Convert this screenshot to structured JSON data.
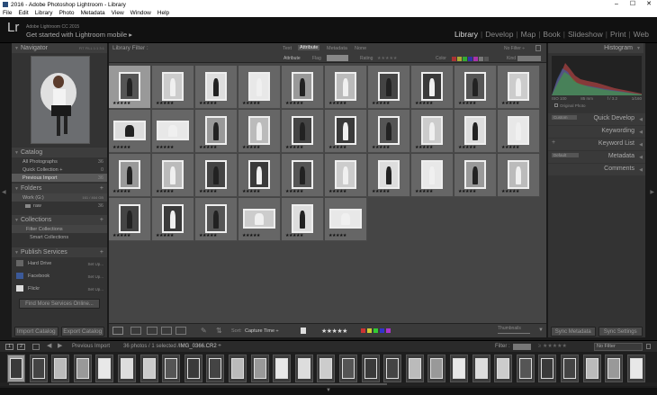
{
  "window": {
    "title": "2016 - Adobe Photoshop Lightroom - Library",
    "controls": [
      "–",
      "☐",
      "✕"
    ]
  },
  "menu": [
    "File",
    "Edit",
    "Library",
    "Photo",
    "Metadata",
    "View",
    "Window",
    "Help"
  ],
  "identity": {
    "logo": "Lr",
    "version": "Adobe Lightroom CC 2015",
    "promo": "Get started with Lightroom mobile ▸"
  },
  "modules": {
    "items": [
      "Library",
      "Develop",
      "Map",
      "Book",
      "Slideshow",
      "Print",
      "Web"
    ],
    "active": "Library"
  },
  "left": {
    "navigator": {
      "title": "Navigator",
      "zoom": "FIT  FILL  1:1  3:1"
    },
    "catalog": {
      "title": "Catalog",
      "items": [
        {
          "label": "All Photographs",
          "count": "36"
        },
        {
          "label": "Quick Collection +",
          "count": "0"
        },
        {
          "label": "Previous Import",
          "count": "36"
        }
      ]
    },
    "folders": {
      "title": "Folders",
      "drive": "Work (G:)",
      "drive_info": "161 / 464 GB",
      "items": [
        {
          "label": "raw",
          "count": "36"
        }
      ]
    },
    "collections": {
      "title": "Collections",
      "items": [
        "Filter Collections",
        "Smart Collections"
      ]
    },
    "publish": {
      "title": "Publish Services",
      "items": [
        {
          "label": "Hard Drive",
          "action": "Set Up..."
        },
        {
          "label": "Facebook",
          "action": "Set Up..."
        },
        {
          "label": "Flickr",
          "action": "Set Up..."
        }
      ],
      "find_more": "Find More Services Online..."
    },
    "buttons": {
      "import": "Import Catalog",
      "export": "Export Catalog"
    }
  },
  "filterbar": {
    "title": "Library Filter :",
    "tabs": [
      "Text",
      "Attribute",
      "Metadata",
      "None"
    ],
    "active_tab": "Attribute",
    "nofilter": "No Filter ÷",
    "attribute_label": "Attribute",
    "flag_label": "Flag",
    "rating_label": "Rating",
    "color_label": "Color",
    "kind_label": "Kind"
  },
  "grid": {
    "rows": [
      [
        1,
        2,
        3,
        4,
        5,
        6,
        7,
        8,
        9,
        10
      ],
      [
        11,
        12,
        13,
        14,
        15,
        16,
        17,
        18,
        19,
        20
      ],
      [
        21,
        22,
        23,
        24,
        25,
        26,
        27,
        28,
        29,
        30
      ],
      [
        31,
        32,
        33,
        34,
        35,
        36
      ]
    ],
    "selected": 1,
    "stars": "★★★★★"
  },
  "toolbar": {
    "sort_label": "Sort:",
    "sort_value": "Capture Time ÷",
    "stars": "★★★★★",
    "thumbnails_label": "Thumbnails"
  },
  "right": {
    "histogram": {
      "title": "Histogram",
      "iso": "ISO 100",
      "focal": "85 mm",
      "aperture": "f / 3.2",
      "shutter": "1/160",
      "original": "Original Photo"
    },
    "panels": [
      "Quick Develop",
      "Keywording",
      "Keyword List",
      "Metadata",
      "Comments"
    ],
    "quickdev_preset": "Custom",
    "metadata_preset": "Default",
    "buttons": {
      "sync_metadata": "Sync Metadata",
      "sync_settings": "Sync Settings"
    }
  },
  "bottombar": {
    "source": "Previous Import",
    "count": "36 photos / 1 selected /",
    "filename": "IMG_0366.CR2 ÷",
    "filter_label": "Filter :",
    "nofilter": "No Filter"
  },
  "colors": {
    "accent": "#dddddd",
    "panel": "#333333",
    "grid": "#454545",
    "selected_cell": "#999999"
  }
}
